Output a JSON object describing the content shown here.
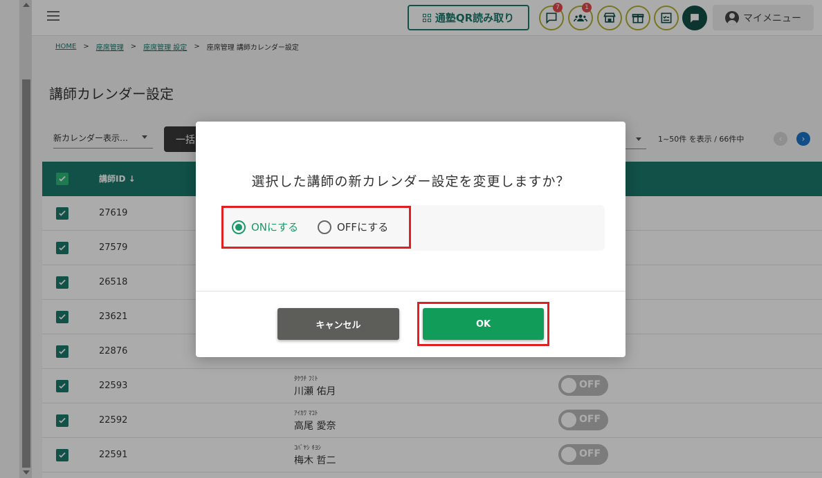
{
  "header": {
    "qr_button_label": "通塾QR読み取り",
    "badges": {
      "chat": "7",
      "group": "1"
    },
    "my_menu_label": "マイメニュー"
  },
  "breadcrumb": {
    "home": "HOME",
    "seat": "座席管理",
    "seat_settings": "座席管理 設定",
    "current": "座席管理 講師カレンダー設定",
    "separator": ">"
  },
  "page": {
    "title": "講師カレンダー設定"
  },
  "toolbar": {
    "select_value": "新カレンダー表示…",
    "bulk_button_label": "一括",
    "pager_info": "1~50件 を表示 / 66件中",
    "prev": "‹",
    "next": "›"
  },
  "table": {
    "header_id": "講師ID",
    "sort_arrow": "↓",
    "rows": [
      {
        "id": "27619",
        "kana": "",
        "name": "",
        "toggle": ""
      },
      {
        "id": "27579",
        "kana": "",
        "name": "",
        "toggle": ""
      },
      {
        "id": "26518",
        "kana": "",
        "name": "",
        "toggle": ""
      },
      {
        "id": "23621",
        "kana": "",
        "name": "",
        "toggle": ""
      },
      {
        "id": "22876",
        "kana": "",
        "name": "",
        "toggle": ""
      },
      {
        "id": "22593",
        "kana": "ﾀｹｳﾁ ﾌﾐﾄ",
        "name": "川瀬 佑月",
        "toggle": "OFF"
      },
      {
        "id": "22592",
        "kana": "ｱｲｶﾜ ﾏｺﾄ",
        "name": "高尾 愛奈",
        "toggle": "OFF"
      },
      {
        "id": "22591",
        "kana": "ｺﾊﾞﾔｼ ｷﾖｼ",
        "name": "梅木 哲二",
        "toggle": "OFF"
      }
    ]
  },
  "dialog": {
    "title": "選択した講師の新カレンダー設定を変更しますか？",
    "option_on": "ONにする",
    "option_off": "OFFにする",
    "selected": "on",
    "cancel_label": "キャンセル",
    "ok_label": "OK"
  },
  "colors": {
    "primary": "#1a7a6a",
    "ok": "#119c5a",
    "highlight": "#e02020"
  }
}
